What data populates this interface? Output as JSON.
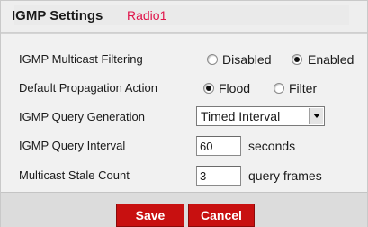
{
  "header": {
    "title": "IGMP Settings",
    "radio_name": "Radio1"
  },
  "multicast_filtering": {
    "label": "IGMP Multicast Filtering",
    "options": [
      "Disabled",
      "Enabled"
    ],
    "selected": "Enabled"
  },
  "propagation": {
    "label": "Default Propagation Action",
    "options": [
      "Flood",
      "Filter"
    ],
    "selected": "Flood"
  },
  "query_generation": {
    "label": "IGMP Query Generation",
    "value": "Timed Interval"
  },
  "query_interval": {
    "label": "IGMP Query Interval",
    "value": "60",
    "unit": "seconds"
  },
  "stale_count": {
    "label": "Multicast Stale Count",
    "value": "3",
    "unit": "query frames"
  },
  "buttons": {
    "save": "Save",
    "cancel": "Cancel"
  },
  "colors": {
    "accent": "#e0144a",
    "button": "#c81010",
    "panel": "#f1f1f1",
    "footer": "#dcdcdc"
  }
}
